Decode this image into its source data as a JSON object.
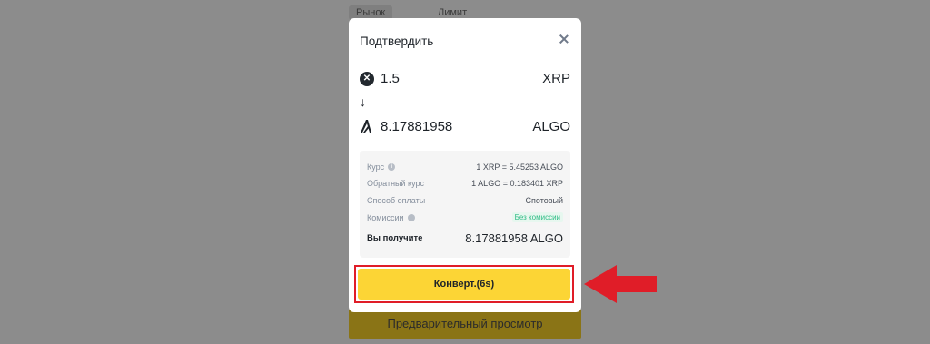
{
  "background": {
    "tabs": [
      {
        "label": "Рынок"
      },
      {
        "label": "Лимит"
      }
    ],
    "preview_button_label": "Предварительный просмотр"
  },
  "modal": {
    "title": "Подтвердить",
    "from": {
      "amount": "1.5",
      "asset": "XRP",
      "icon": "xrp-icon"
    },
    "to": {
      "amount": "8.17881958",
      "asset": "ALGO",
      "icon": "algo-icon"
    },
    "details": {
      "rate_label": "Курс",
      "rate_value": "1 XRP = 5.45253 ALGO",
      "inverse_rate_label": "Обратный курс",
      "inverse_rate_value": "1 ALGO = 0.183401 XRP",
      "payment_label": "Способ оплаты",
      "payment_value": "Спотовый",
      "fees_label": "Комиссии",
      "fees_value": "Без комиссии",
      "receive_label": "Вы получите",
      "receive_value": "8.17881958 ALGO"
    },
    "convert_button_label": "Конверт.(6s)"
  },
  "colors": {
    "accent_yellow": "#fcd535",
    "highlight_red": "#e01d28",
    "fee_green": "#2ebd85"
  }
}
